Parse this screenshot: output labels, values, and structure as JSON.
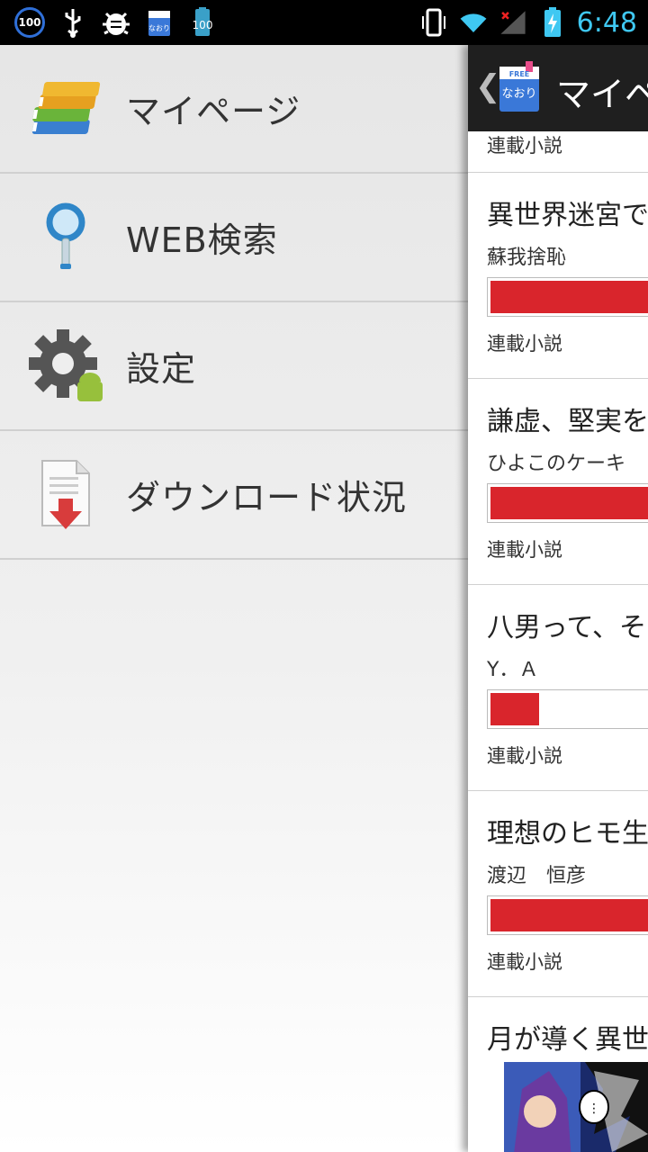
{
  "status_bar": {
    "left_badge": "100",
    "battery_app_badge": "100",
    "time": "6:48",
    "icons": [
      "badge-100-icon",
      "usb-icon",
      "bug-icon",
      "naori-app-icon",
      "battery-100-icon",
      "vibrate-icon",
      "wifi-icon",
      "signal-icon",
      "battery-charging-icon"
    ]
  },
  "drawer": {
    "items": [
      {
        "label": "マイページ",
        "icon": "books-icon"
      },
      {
        "label": "WEB検索",
        "icon": "magnifier-icon"
      },
      {
        "label": "設定",
        "icon": "settings-gear-icon"
      },
      {
        "label": "ダウンロード状況",
        "icon": "download-icon"
      }
    ]
  },
  "main": {
    "title": "マイペ",
    "logo_text_top": "FREE",
    "logo_text_main": "なおり",
    "top_partial_type": "連載小説",
    "novels": [
      {
        "title": "異世界迷宮で",
        "author": "蘇我捨恥",
        "progress": 0.95,
        "type": "連載小説"
      },
      {
        "title": "謙虚、堅実を",
        "author": "ひよこのケーキ",
        "progress": 0.95,
        "type": "連載小説"
      },
      {
        "title": "八男って、そ",
        "author": "Y．Ａ",
        "progress": 0.28,
        "type": "連載小説"
      },
      {
        "title": "理想のヒモ生",
        "author": "渡辺　恒彦",
        "progress": 0.95,
        "type": "連載小説"
      }
    ],
    "last_title": "月が導く異世"
  },
  "colors": {
    "progress_red": "#d9252c",
    "clock_blue": "#3fc8f2",
    "actionbar": "#1f1f1f"
  }
}
